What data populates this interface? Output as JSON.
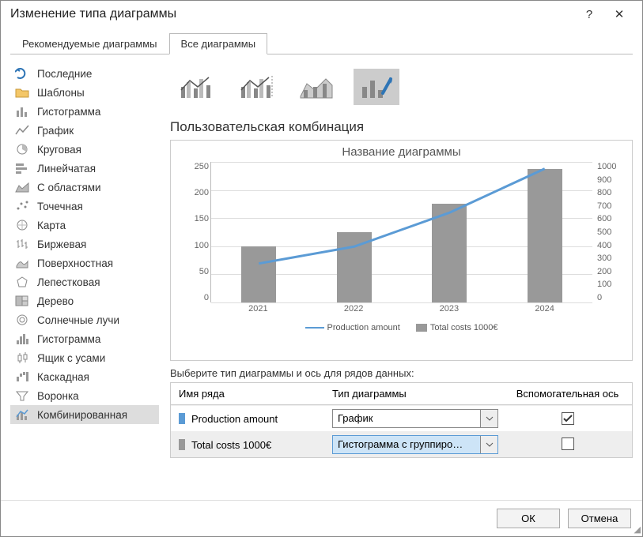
{
  "titlebar": {
    "title": "Изменение типа диаграммы"
  },
  "tabs": {
    "recommended": "Рекомендуемые диаграммы",
    "all": "Все диаграммы"
  },
  "sidebar": {
    "items": [
      {
        "label": "Последние"
      },
      {
        "label": "Шаблоны"
      },
      {
        "label": "Гистограмма"
      },
      {
        "label": "График"
      },
      {
        "label": "Круговая"
      },
      {
        "label": "Линейчатая"
      },
      {
        "label": "С областями"
      },
      {
        "label": "Точечная"
      },
      {
        "label": "Карта"
      },
      {
        "label": "Биржевая"
      },
      {
        "label": "Поверхностная"
      },
      {
        "label": "Лепестковая"
      },
      {
        "label": "Дерево"
      },
      {
        "label": "Солнечные лучи"
      },
      {
        "label": "Гистограмма"
      },
      {
        "label": "Ящик с усами"
      },
      {
        "label": "Каскадная"
      },
      {
        "label": "Воронка"
      },
      {
        "label": "Комбинированная"
      }
    ]
  },
  "main": {
    "subtype_title": "Пользовательская комбинация",
    "chart_title": "Название диаграммы",
    "legend": {
      "s1": "Production amount",
      "s2": "Total costs 1000€"
    },
    "series_prompt": "Выберите тип диаграммы и ось для рядов данных:",
    "grid": {
      "h_name": "Имя ряда",
      "h_type": "Тип диаграммы",
      "h_axis": "Вспомогательная ось",
      "r1": {
        "name": "Production amount",
        "type": "График",
        "checked": true
      },
      "r2": {
        "name": "Total costs 1000€",
        "type": "Гистограмма с группиро…",
        "checked": false
      }
    }
  },
  "chart_data": {
    "type": "combo",
    "title": "Название диаграммы",
    "categories": [
      "2021",
      "2022",
      "2023",
      "2024"
    ],
    "series": [
      {
        "name": "Production amount",
        "type": "line",
        "axis": "primary",
        "values": [
          100,
          125,
          175,
          240
        ]
      },
      {
        "name": "Total costs 1000€",
        "type": "bar",
        "axis": "secondary",
        "values": [
          400,
          500,
          700,
          950
        ]
      }
    ],
    "y_primary": {
      "min": 0,
      "max": 250,
      "ticks": [
        0,
        50,
        100,
        150,
        200,
        250
      ]
    },
    "y_secondary": {
      "min": 0,
      "max": 1000,
      "ticks": [
        0,
        100,
        200,
        300,
        400,
        500,
        600,
        700,
        800,
        900,
        1000
      ]
    },
    "xlabel": "",
    "ylabel": ""
  },
  "footer": {
    "ok": "ОК",
    "cancel": "Отмена"
  }
}
